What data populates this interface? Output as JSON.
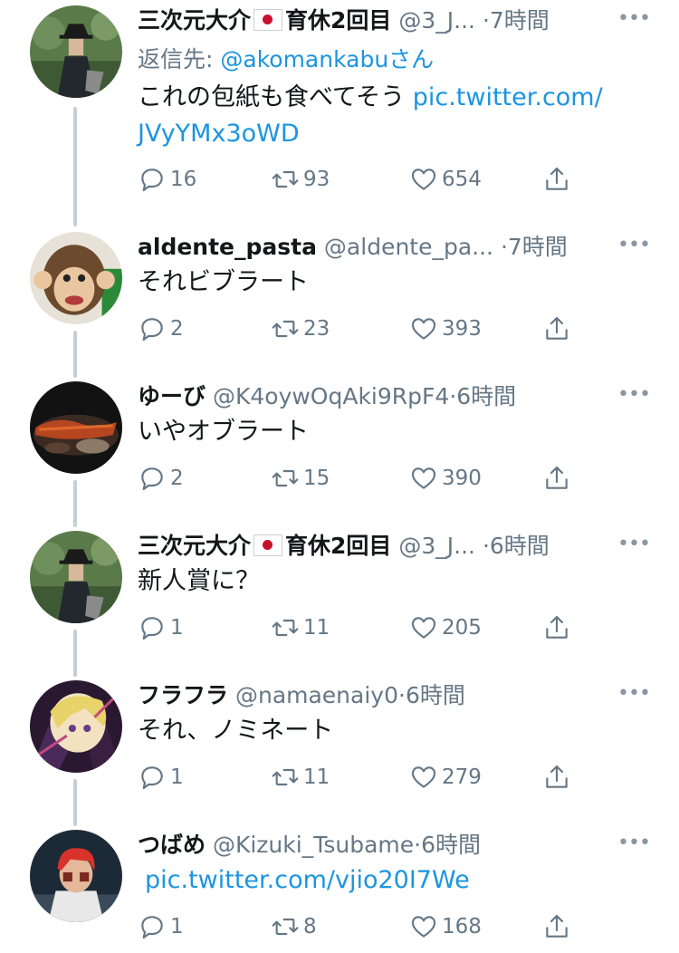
{
  "tweets": [
    {
      "name": "三次元大介",
      "name_suffix": "育休2回目",
      "has_flag": true,
      "handle": "@3_J...",
      "dot": "·",
      "time": "7時間",
      "more": "•••",
      "replying_prefix": "返信先: ",
      "replying_handle": "@akomankabuさん",
      "text_line1": "これの包紙も食べてそう",
      "link_line1": "pic.twitter.com/",
      "link_line2": "JVyYMx3oWD",
      "replies": "16",
      "retweets": "93",
      "likes": "654",
      "avatar": "avatar-man-in-hat"
    },
    {
      "name": "aldente_pasta",
      "handle": "@aldente_pa...",
      "dot": "·",
      "time": "7時間",
      "more": "•••",
      "text_line1": "それビブラート",
      "replies": "2",
      "retweets": "23",
      "likes": "393",
      "avatar": "avatar-monkey-toy"
    },
    {
      "name": "ゆーび",
      "handle": "@K4oywOqAki9RpF4",
      "dot": "·",
      "time": "6時間",
      "more": "•••",
      "text_line1": "いやオブラート",
      "replies": "2",
      "retweets": "15",
      "likes": "390",
      "avatar": "avatar-grilled-food"
    },
    {
      "name": "三次元大介",
      "name_suffix": "育休2回目",
      "has_flag": true,
      "handle": "@3_J...",
      "dot": "·",
      "time": "6時間",
      "more": "•••",
      "text_line1": "新人賞に？",
      "replies": "1",
      "retweets": "11",
      "likes": "205",
      "avatar": "avatar-man-in-hat"
    },
    {
      "name": "フラフラ",
      "handle": "@namaenaiy0",
      "dot": "·",
      "time": "6時間",
      "more": "•••",
      "text_line1": "それ、ノミネート",
      "replies": "1",
      "retweets": "11",
      "likes": "279",
      "avatar": "avatar-anime-character"
    },
    {
      "name": "つばめ",
      "handle": "@Kizuki_Tsubame",
      "dot": "·",
      "time": "6時間",
      "more": "•••",
      "link_line1": "pic.twitter.com/vjio20I7We",
      "replies": "1",
      "retweets": "8",
      "likes": "168",
      "avatar": "avatar-red-hair-person"
    }
  ],
  "icons": {
    "reply": "reply-icon",
    "retweet": "retweet-icon",
    "like": "like-icon",
    "share": "share-icon"
  },
  "colors": {
    "link": "#1b95e0",
    "secondary_text": "#657786",
    "thread_line": "#c4cfd6"
  }
}
